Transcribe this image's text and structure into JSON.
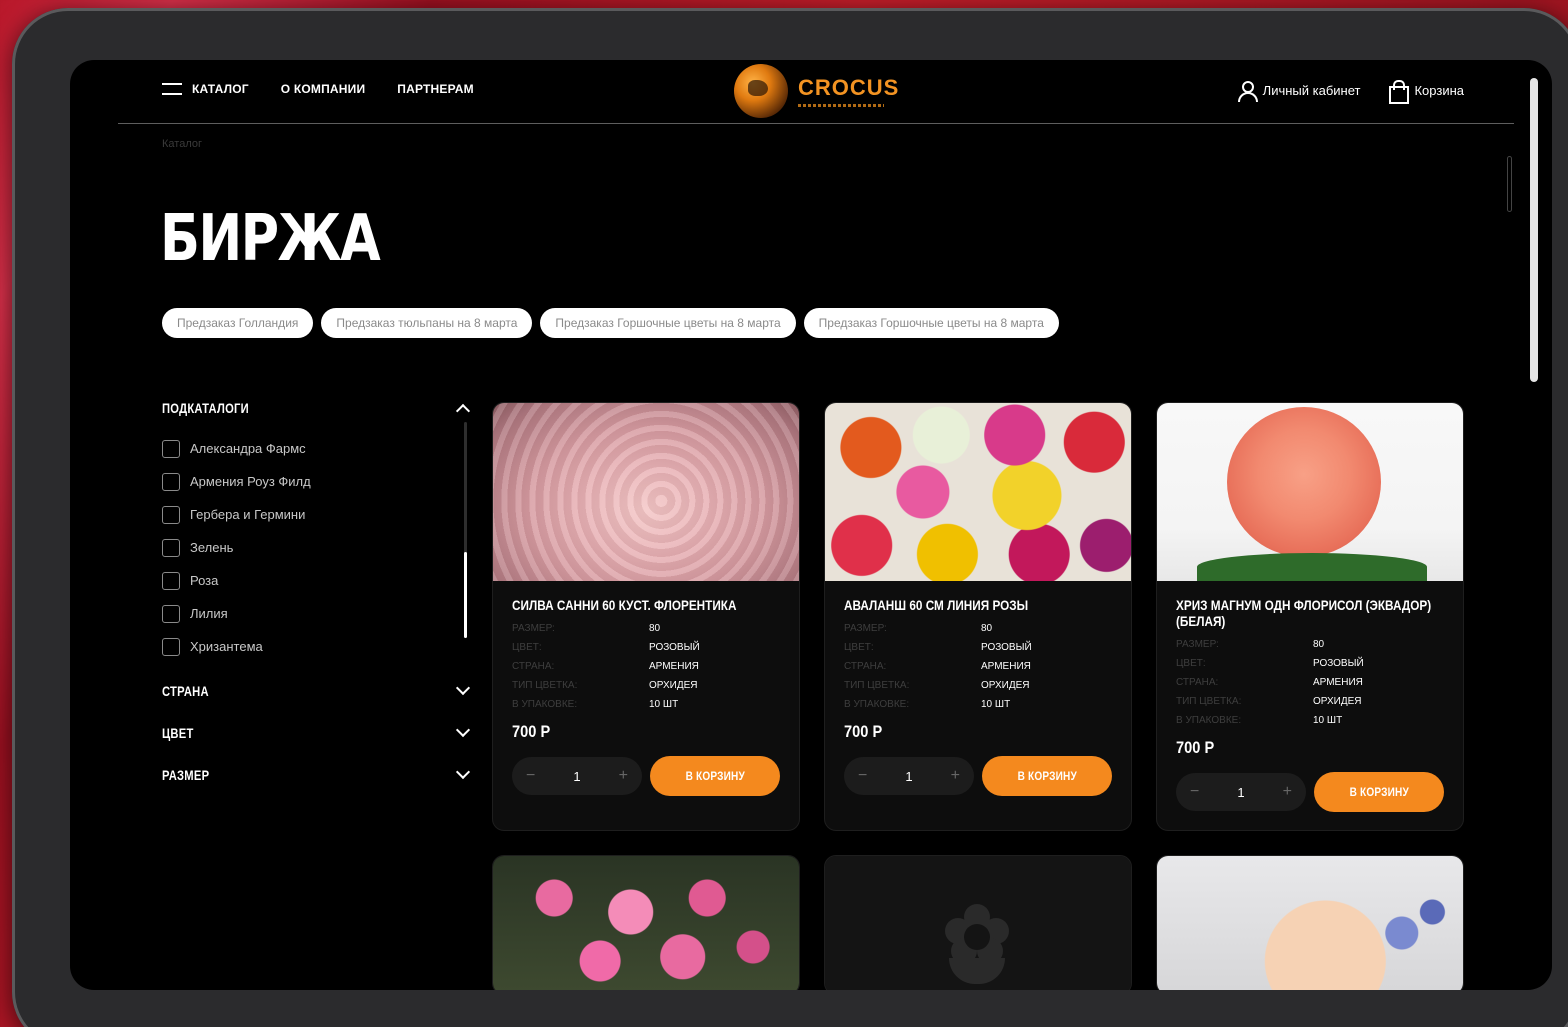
{
  "header": {
    "nav": [
      "КАТАЛОГ",
      "О КОМПАНИИ",
      "ПАРТНЕРАМ"
    ],
    "brand": "CROCUS",
    "account_label": "Личный кабинет",
    "cart_label": "Корзина"
  },
  "breadcrumb": "Каталог",
  "page_title": "БИРЖА",
  "chips": [
    "Предзаказ Голландия",
    "Предзаказ тюльпаны на 8 марта",
    "Предзаказ Горшочные цветы на 8 марта",
    "Предзаказ Горшочные цветы на 8 марта"
  ],
  "sidebar": {
    "subcatalogs_label": "ПОДКАТАЛОГИ",
    "subcatalogs": [
      "Александра Фармс",
      "Армения Роуз Филд",
      "Гербера и Гермини",
      "Зелень",
      "Роза",
      "Лилия",
      "Хризантема"
    ],
    "country_label": "СТРАНА",
    "color_label": "ЦВЕТ",
    "size_label": "РАЗМЕР"
  },
  "spec_labels": {
    "size": "РАЗМЕР:",
    "color": "ЦВЕТ:",
    "country": "СТРАНА:",
    "type": "ТИП ЦВЕТКА:",
    "pack": "В УПАКОВКЕ:"
  },
  "products": [
    {
      "name": "СИЛВА САННИ 60 КУСТ. ФЛОРЕНТИКА",
      "size": "80",
      "color": "РОЗОВЫЙ",
      "country": "АРМЕНИЯ",
      "type": "ОРХИДЕЯ",
      "pack": "10 ШТ",
      "price": "700 Р",
      "qty": "1",
      "button": "В КОРЗИНУ"
    },
    {
      "name": "АВАЛАНШ 60 СМ ЛИНИЯ РОЗЫ",
      "size": "80",
      "color": "РОЗОВЫЙ",
      "country": "АРМЕНИЯ",
      "type": "ОРХИДЕЯ",
      "pack": "10 ШТ",
      "price": "700 Р",
      "qty": "1",
      "button": "В КОРЗИНУ"
    },
    {
      "name": "ХРИЗ МАГНУМ ОДН ФЛОРИСОЛ (ЭКВАДОР) (БЕЛАЯ)",
      "size": "80",
      "color": "РОЗОВЫЙ",
      "country": "АРМЕНИЯ",
      "type": "ОРХИДЕЯ",
      "pack": "10 ШТ",
      "price": "700 Р",
      "qty": "1",
      "button": "В КОРЗИНУ"
    }
  ],
  "qty_controls": {
    "minus": "−",
    "plus": "+"
  }
}
